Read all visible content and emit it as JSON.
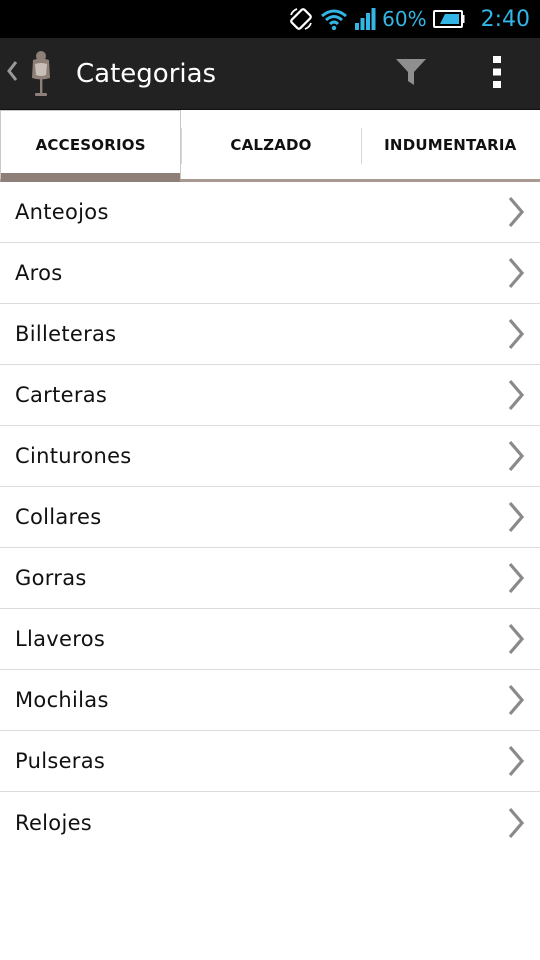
{
  "status_bar": {
    "battery_percent": "60%",
    "time": "2:40",
    "icons": [
      "screen-rotation-icon",
      "wifi-icon",
      "signal-icon",
      "battery-icon"
    ],
    "accent_color": "#33b5e5"
  },
  "action_bar": {
    "title": "Categorias",
    "icons": [
      "back-chevron-icon",
      "app-logo-icon",
      "filter-icon",
      "overflow-menu-icon"
    ],
    "background_color": "#222222"
  },
  "tabs": [
    {
      "label": "ACCESORIOS",
      "selected": true
    },
    {
      "label": "CALZADO",
      "selected": false
    },
    {
      "label": "INDUMENTARIA",
      "selected": false
    }
  ],
  "tab_indicator_color": "#8e7f79",
  "categories": [
    {
      "label": "Anteojos"
    },
    {
      "label": "Aros"
    },
    {
      "label": "Billeteras"
    },
    {
      "label": "Carteras"
    },
    {
      "label": "Cinturones"
    },
    {
      "label": "Collares"
    },
    {
      "label": "Gorras"
    },
    {
      "label": "Llaveros"
    },
    {
      "label": "Mochilas"
    },
    {
      "label": "Pulseras"
    },
    {
      "label": "Relojes"
    }
  ]
}
